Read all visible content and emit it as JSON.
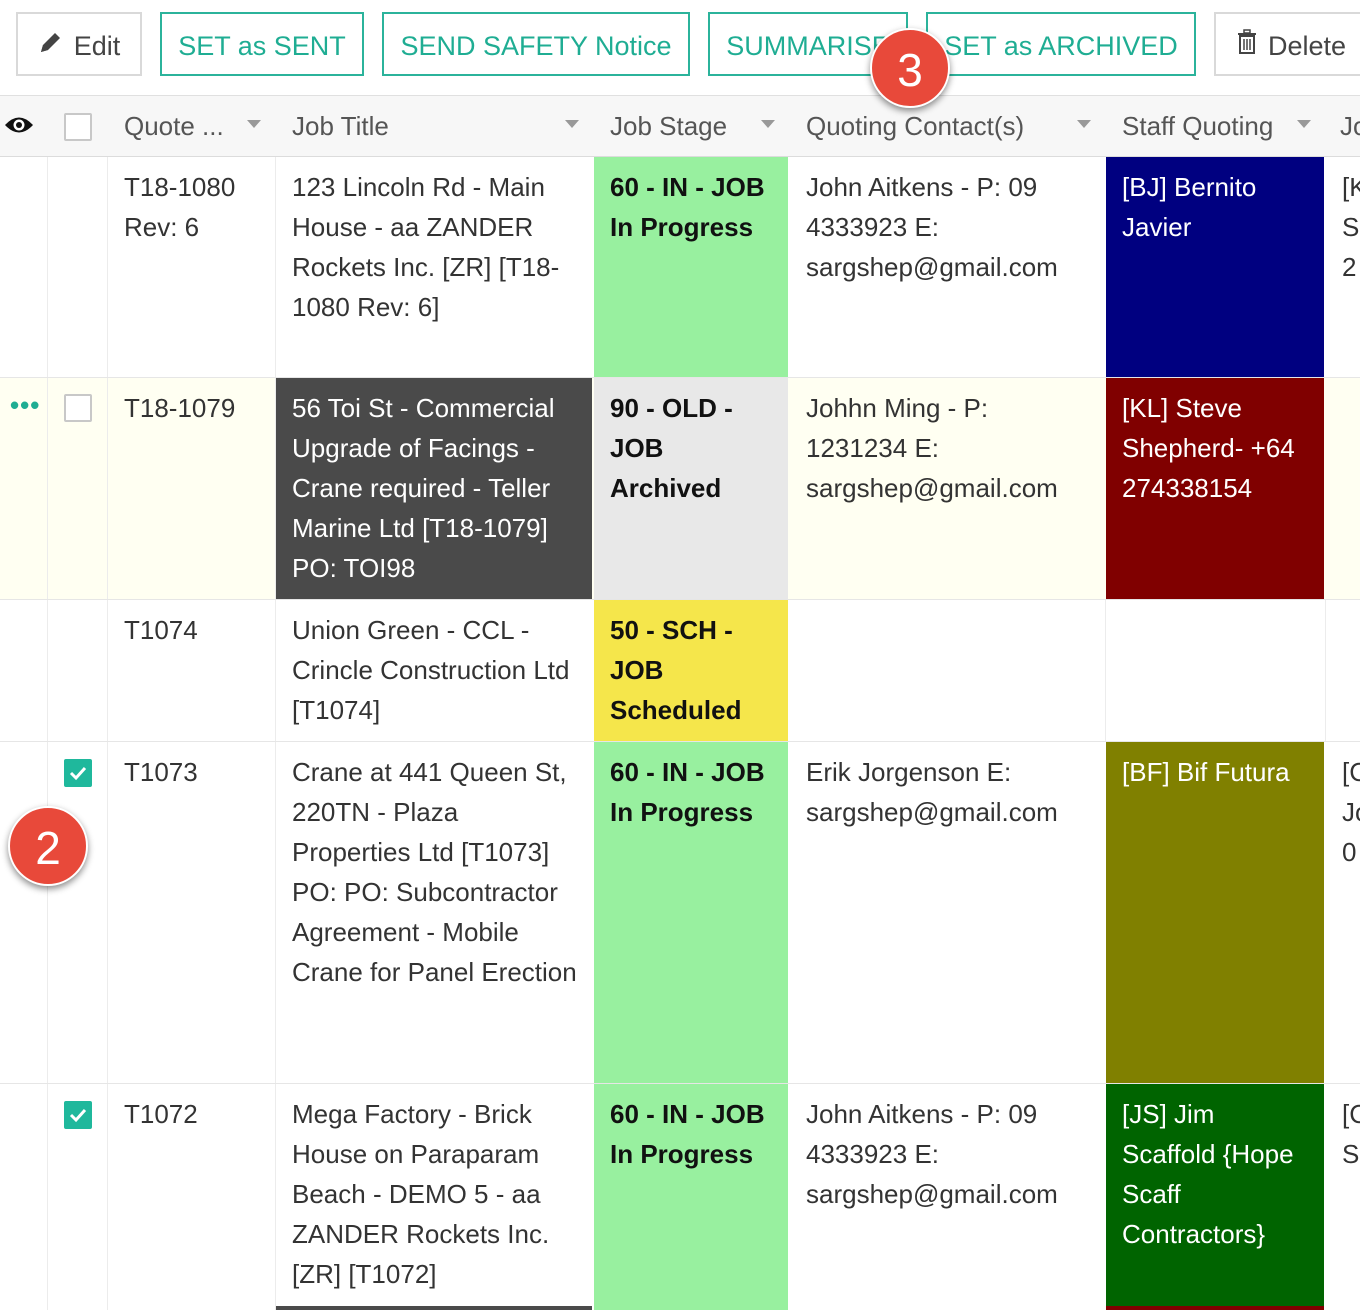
{
  "toolbar": {
    "edit_label": "Edit",
    "set_sent_label": "SET as SENT",
    "send_safety_label": "SEND SAFETY Notice",
    "summarise_label": "SUMMARISE",
    "set_archived_label": "SET as ARCHIVED",
    "delete_label": "Delete",
    "edit_icon": "pencil-icon",
    "delete_icon": "trash-icon"
  },
  "columns": {
    "visibility_icon": "eye-icon",
    "quote": "Quote ...",
    "job_title": "Job Title",
    "job_stage": "Job Stage",
    "quoting_contacts": "Quoting Contact(s)",
    "staff_quoting": "Staff Quoting",
    "next_col": "Jo"
  },
  "rows": [
    {
      "quote": "T18-1080 Rev: 6",
      "job_title": "123 Lincoln Rd - Main House - aa ZANDER Rockets Inc. [ZR] [T18-1080 Rev: 6]",
      "stage": "60 - IN - JOB In Progress",
      "stage_color": "#98f09f",
      "contact": "John Aitkens - P: 09 4333923 E: sargshep@gmail.com",
      "staff": "[BJ] Bernito Javier",
      "staff_color": "#000080",
      "next": "[K S 2",
      "checked": false,
      "title_dark": false
    },
    {
      "quote": "T18-1079",
      "job_title": "56 Toi St - Commercial Upgrade of Facings - Crane required - Teller Marine Ltd [T18-1079] PO: TOI98",
      "stage": "90 - OLD - JOB Archived",
      "stage_color": "#e8e8e8",
      "contact": "Johhn Ming - P: 1231234 E: sargshep@gmail.com",
      "staff": "[KL] Steve Shepherd- +64 274338154",
      "staff_color": "#800000",
      "next": "",
      "checked": false,
      "title_dark": true,
      "row_menu": "•••"
    },
    {
      "quote": "T1074",
      "job_title": "Union Green - CCL - Crincle Construction Ltd [T1074]",
      "stage": "50 - SCH - JOB Scheduled",
      "stage_color": "#f5e64b",
      "contact": "",
      "staff": "",
      "staff_color": "#ffffff",
      "next": "",
      "checked": false,
      "title_dark": false
    },
    {
      "quote": "T1073",
      "job_title": "Crane at 441 Queen St, 220TN - Plaza Properties Ltd [T1073] PO: PO: Subcontractor Agreement - Mobile Crane for Panel Erection",
      "stage": "60 - IN - JOB In Progress",
      "stage_color": "#98f09f",
      "contact": "Erik Jorgenson E: sargshep@gmail.com",
      "staff": "[BF] Bif Futura",
      "staff_color": "#808000",
      "next": "[C Jo 0",
      "checked": true,
      "title_dark": false
    },
    {
      "quote": "T1072",
      "job_title": "Mega Factory - Brick House on Paraparam Beach - DEMO 5 - aa ZANDER Rockets Inc. [ZR] [T1072]",
      "stage": "60 - IN - JOB In Progress",
      "stage_color": "#98f09f",
      "contact": "John Aitkens - P: 09 4333923 E: sargshep@gmail.com",
      "staff": "[JS] Jim Scaffold {Hope Scaff Contractors}",
      "staff_color": "#006400",
      "next": "[C S",
      "checked": true,
      "title_dark": false
    }
  ],
  "badges": {
    "step2": "2",
    "step3": "3"
  },
  "colors": {
    "accent": "#1fad93",
    "badge": "#e8493a",
    "title_dark_bg": "#4a4a4a",
    "row_highlight": "#fffff2"
  }
}
